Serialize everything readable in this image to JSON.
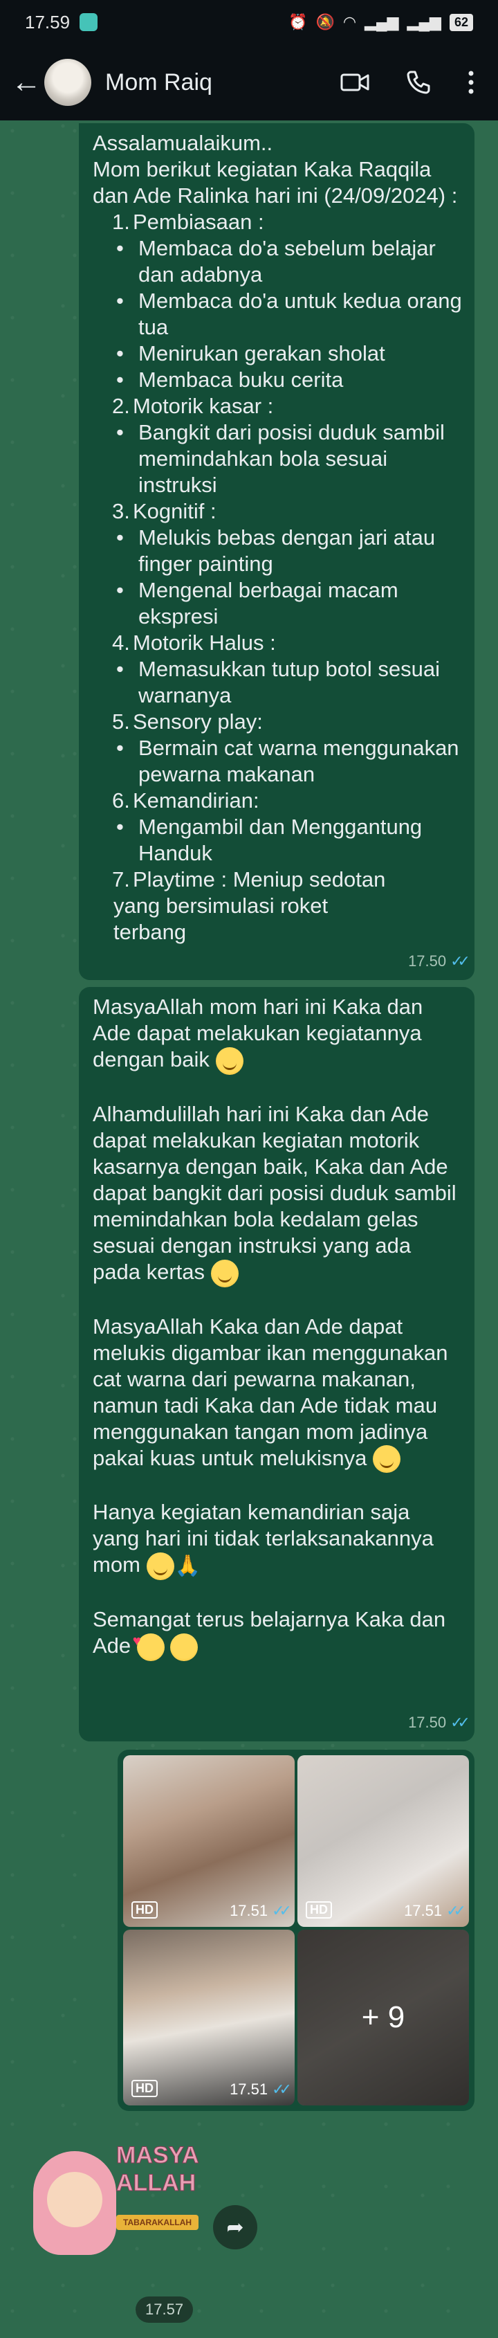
{
  "status_bar": {
    "time": "17.59",
    "battery": "62"
  },
  "header": {
    "contact_name": "Mom Raiq"
  },
  "message1": {
    "intro": "Assalamualaikum..\nMom berikut kegiatan Kaka Raqqila dan Ade Ralinka hari ini (24/09/2024) :",
    "sections": [
      {
        "number": "1.",
        "title": "Pembiasaan :",
        "items": [
          "Membaca do'a sebelum belajar dan adabnya",
          "Membaca do'a untuk kedua orang tua",
          "Menirukan gerakan sholat",
          "Membaca buku cerita"
        ]
      },
      {
        "number": "2.",
        "title": "Motorik kasar :",
        "items": [
          "Bangkit dari posisi duduk sambil memindahkan bola sesuai instruksi"
        ]
      },
      {
        "number": "3.",
        "title": "Kognitif :",
        "items": [
          "Melukis bebas dengan jari atau finger painting",
          "Mengenal berbagai macam ekspresi"
        ]
      },
      {
        "number": "4.",
        "title": "Motorik Halus :",
        "items": [
          "Memasukkan tutup botol sesuai warnanya"
        ]
      },
      {
        "number": "5.",
        "title": "Sensory play:",
        "items": [
          "Bermain  cat warna menggunakan pewarna makanan"
        ]
      },
      {
        "number": "6.",
        "title": "Kemandirian:",
        "items": [
          "Mengambil dan Menggantung Handuk"
        ]
      },
      {
        "number": "7.",
        "title": "Playtime : Meniup sedotan yang bersimulasi roket terbang",
        "items": []
      }
    ],
    "time": "17.50"
  },
  "message2": {
    "p1": "MasyaAllah mom hari ini Kaka dan Ade dapat melakukan kegiatannya dengan baik",
    "p2": "Alhamdulillah hari ini Kaka dan Ade dapat melakukan kegiatan motorik kasarnya dengan baik, Kaka dan Ade dapat bangkit dari posisi duduk sambil memindahkan bola kedalam gelas sesuai dengan instruksi yang ada pada kertas",
    "p3": "MasyaAllah Kaka dan Ade dapat melukis digambar ikan menggunakan cat warna dari pewarna makanan, namun tadi Kaka dan Ade tidak mau menggunakan tangan mom jadinya pakai kuas untuk melukisnya",
    "p4": "Hanya kegiatan kemandirian saja yang hari ini tidak terlaksanakannya mom",
    "p5": "Semangat terus belajarnya Kaka dan Ade",
    "time": "17.50"
  },
  "media": {
    "hd_label": "HD",
    "items": [
      {
        "time": "17.51"
      },
      {
        "time": "17.51"
      },
      {
        "time": "17.51"
      }
    ],
    "more_count": "+ 9"
  },
  "sticker": {
    "line1": "MASYA",
    "line2": "ALLAH",
    "tag": "TABARAKALLAH",
    "time": "17.57"
  }
}
